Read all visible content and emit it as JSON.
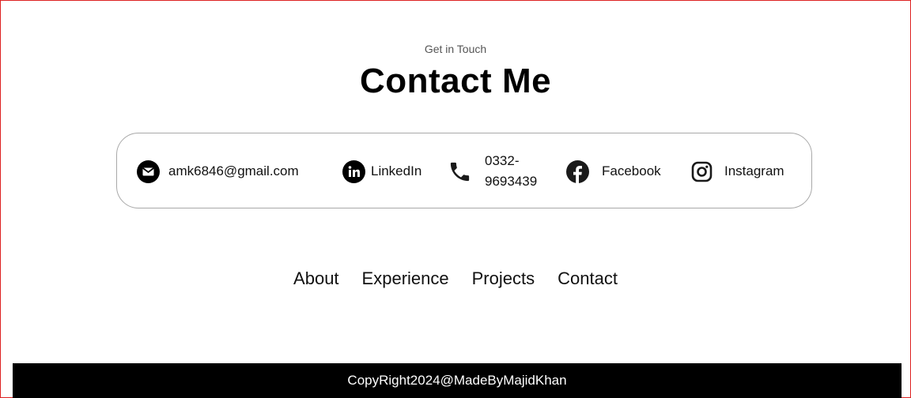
{
  "header": {
    "subtitle": "Get in Touch",
    "title": "Contact Me"
  },
  "contacts": [
    {
      "icon": "email-icon",
      "label": "amk6846@gmail.com"
    },
    {
      "icon": "linkedin-icon",
      "label": "LinkedIn"
    },
    {
      "icon": "phone-icon",
      "label": "0332-9693439"
    },
    {
      "icon": "facebook-icon",
      "label": "Facebook"
    },
    {
      "icon": "instagram-icon",
      "label": "Instagram"
    }
  ],
  "nav": {
    "items": [
      {
        "label": "About"
      },
      {
        "label": "Experience"
      },
      {
        "label": "Projects"
      },
      {
        "label": "Contact"
      }
    ]
  },
  "footer": {
    "text": "CopyRight2024@MadeByMajidKhan"
  },
  "colors": {
    "text": "#111111",
    "border": "#a9a9a9",
    "footer_bg": "#000000",
    "footer_text": "#ffffff"
  }
}
